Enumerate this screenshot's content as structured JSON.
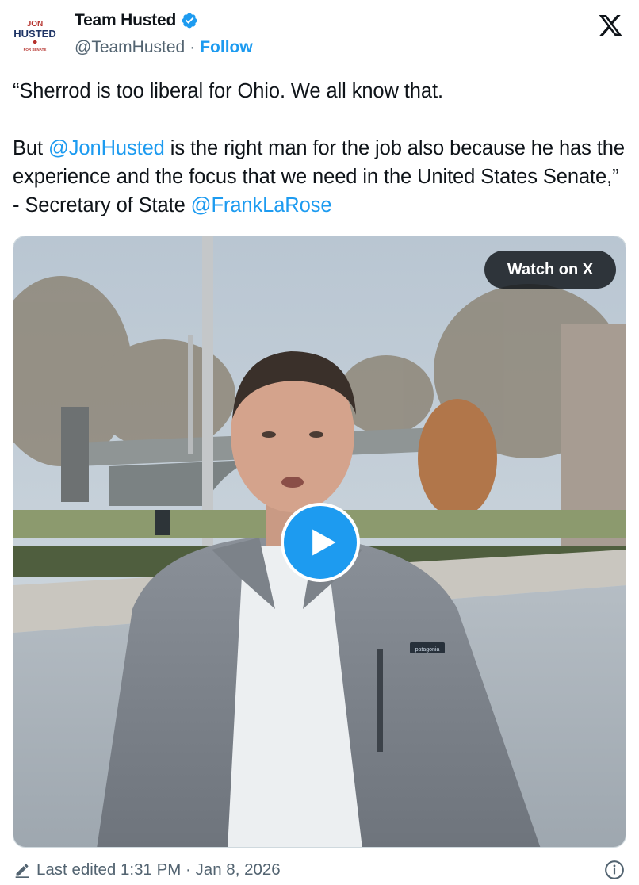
{
  "author": {
    "display_name": "Team Husted",
    "handle": "@TeamHusted",
    "separator": "·",
    "follow_label": "Follow",
    "avatar_text": {
      "top": "JON",
      "name": "HUSTED",
      "bottom": "FOR SENATE"
    }
  },
  "tweet": {
    "line1": "“Sherrod is too liberal for Ohio. We all know that.",
    "p2_part1": "But ",
    "mention1": "@JonHusted",
    "p2_part2": " is the right man for the job also because he has the experience and the focus that we need in the United States Senate,” - Secretary of State ",
    "mention2": "@FrankLaRose"
  },
  "media": {
    "watch_label": "Watch on X",
    "patagonia_tag": "patagonia"
  },
  "footer": {
    "edited_label": "Last edited 1:31 PM · Jan 8, 2026"
  },
  "colors": {
    "accent": "#1d9bf0",
    "text": "#0f1419",
    "secondary": "#536471",
    "avatar_red": "#b5312c",
    "avatar_navy": "#1f3566"
  },
  "icons": [
    "verified-badge-icon",
    "x-logo-icon",
    "play-icon",
    "pencil-icon",
    "info-icon"
  ]
}
